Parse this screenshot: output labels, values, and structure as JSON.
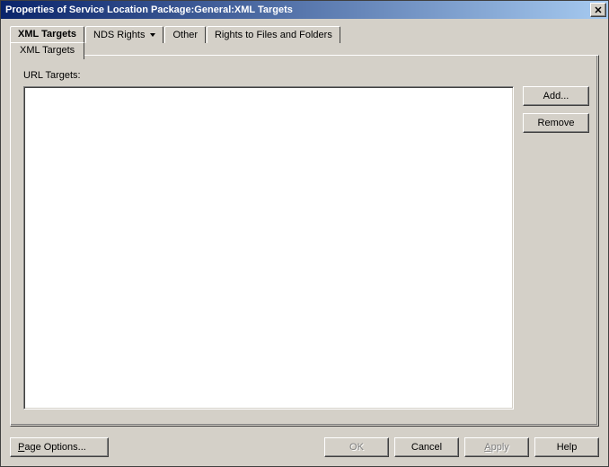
{
  "window": {
    "title": "Properties of Service Location Package:General:XML Targets"
  },
  "tabs": {
    "primary": [
      {
        "label": "XML Targets",
        "dropdown": false,
        "active": true
      },
      {
        "label": "NDS Rights",
        "dropdown": true,
        "active": false
      },
      {
        "label": "Other",
        "dropdown": false,
        "active": false
      },
      {
        "label": "Rights to Files and Folders",
        "dropdown": false,
        "active": false
      }
    ],
    "secondary": [
      {
        "label": "XML Targets",
        "active": true
      }
    ]
  },
  "panel": {
    "urlTargetsLabel": "URL Targets:",
    "items": []
  },
  "sideButtons": {
    "add": "Add...",
    "remove": "Remove"
  },
  "bottom": {
    "pageOptions": "Page Options...",
    "ok": "OK",
    "cancel": "Cancel",
    "apply": "Apply",
    "help": "Help"
  }
}
